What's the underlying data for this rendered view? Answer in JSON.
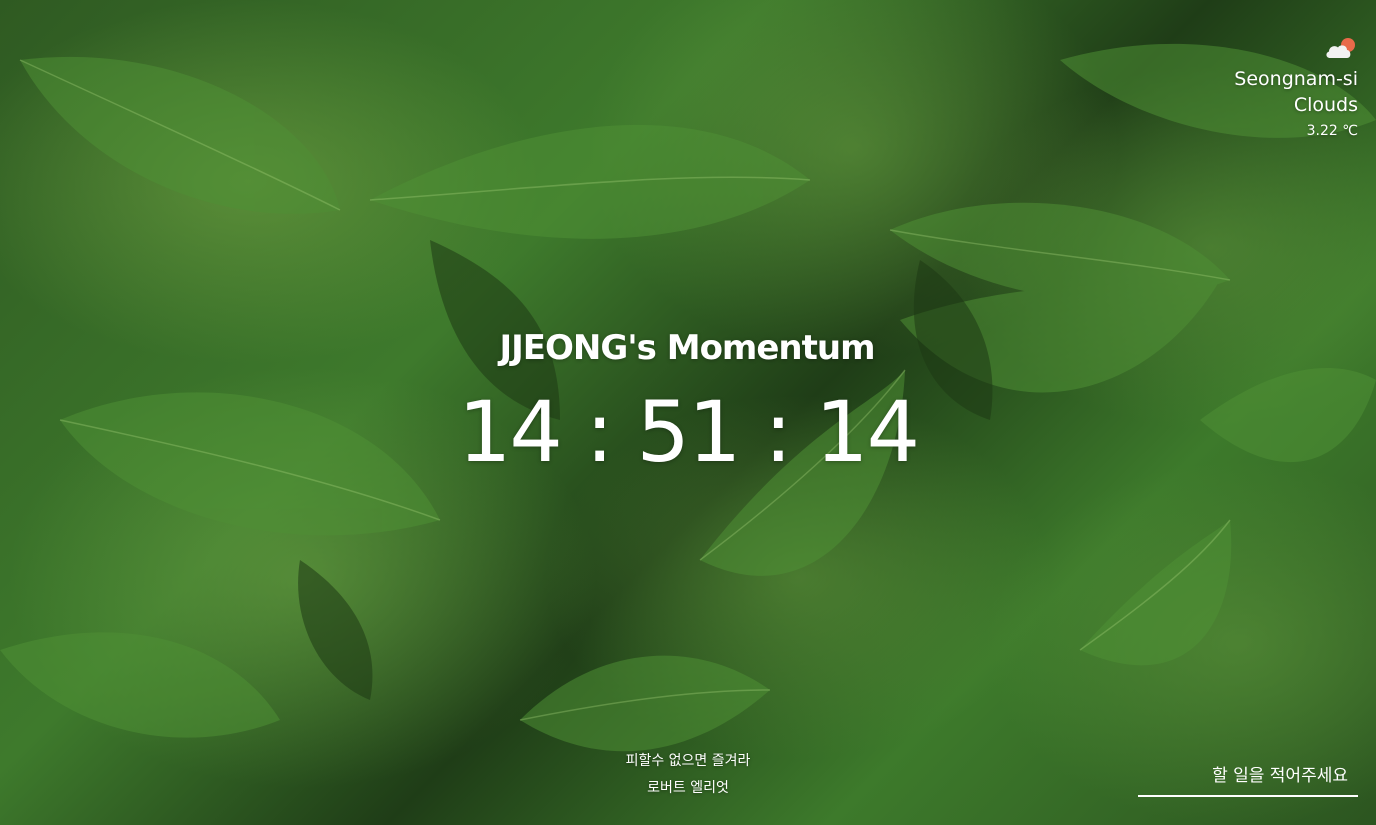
{
  "weather": {
    "icon": "cloud-sun-icon",
    "city": "Seongnam-si",
    "description": "Clouds",
    "temperature": "3.22 ℃"
  },
  "main": {
    "title": "JJEONG's Momentum",
    "clock": "14 : 51 : 14"
  },
  "quote": {
    "text": "피할수 없으면 즐겨라",
    "author": "로버트 엘리엇"
  },
  "todo": {
    "placeholder": "할 일을 적어주세요"
  },
  "colors": {
    "text": "#ffffff",
    "sun_accent": "#e86a4a",
    "background_green": "#3e7a2c"
  }
}
